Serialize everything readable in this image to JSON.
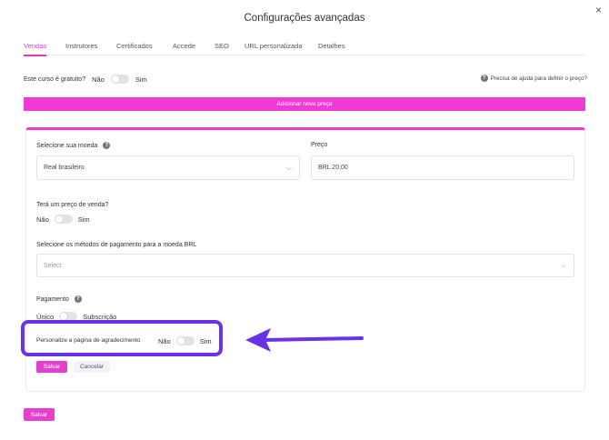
{
  "modal": {
    "title": "Configurações avançadas",
    "close_glyph": "×"
  },
  "tabs": [
    {
      "label": "Vendas",
      "active": true
    },
    {
      "label": "Instrutores"
    },
    {
      "label": "Certificados"
    },
    {
      "label": "Accede"
    },
    {
      "label": "SEO"
    },
    {
      "label": "URL personalizada"
    },
    {
      "label": "Detalhes"
    }
  ],
  "free_course": {
    "label": "Este curso é gratuito?",
    "no": "Não",
    "yes": "Sim"
  },
  "help_link": {
    "icon": "question-circle-icon",
    "label": "Precisa de ajuda para definir o preço?"
  },
  "add_price_button": "Adicionar novo preço",
  "price_card": {
    "currency": {
      "label": "Selecione sua moeda",
      "value": "Real brasileiro"
    },
    "price": {
      "label": "Preço",
      "value": "BRL 20,00"
    },
    "sale_price": {
      "label": "Terá um preço de venda?",
      "no": "Não",
      "yes": "Sim"
    },
    "payment_methods": {
      "label": "Selecione os métodos de pagamento para a moeda BRL",
      "placeholder": "Select"
    },
    "payment": {
      "label": "Pagamento",
      "single": "Único",
      "subscription": "Subscrição"
    },
    "thank_you_page": {
      "label": "Personalize a página de agradecimento",
      "no": "Não",
      "yes": "Sim"
    },
    "save_button": "Salvar",
    "cancel_button": "Cancelar"
  },
  "footer": {
    "save_button": "Salvar"
  },
  "colors": {
    "accent": "#f03ad6",
    "highlight": "#6a32e8"
  }
}
